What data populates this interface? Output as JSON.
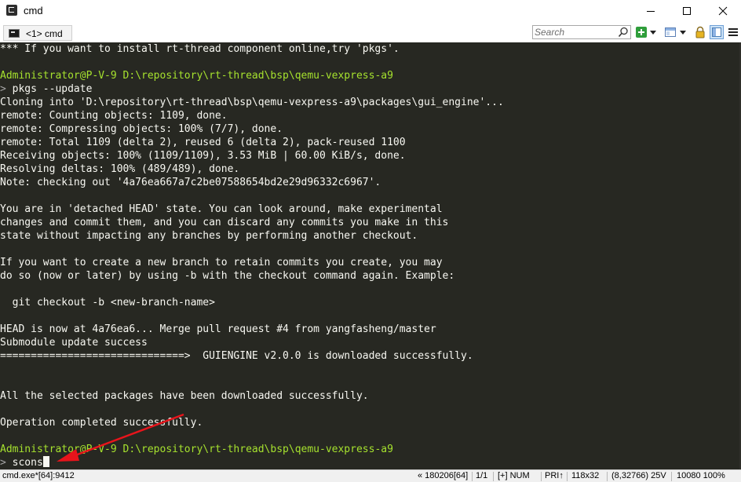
{
  "window": {
    "title": "cmd"
  },
  "tab": {
    "label": "<1> cmd"
  },
  "search": {
    "placeholder": "Search"
  },
  "console": {
    "lines": [
      {
        "text": "*** If you want to install rt-thread component online,try 'pkgs'."
      },
      {
        "text": ""
      },
      {
        "user": "Administrator@P-V-9",
        "path": " D:\\repository\\rt-thread\\bsp\\qemu-vexpress-a9"
      },
      {
        "arrow": ">",
        "cmd": " pkgs --update"
      },
      {
        "text": "Cloning into 'D:\\repository\\rt-thread\\bsp\\qemu-vexpress-a9\\packages\\gui_engine'..."
      },
      {
        "text": "remote: Counting objects: 1109, done."
      },
      {
        "text": "remote: Compressing objects: 100% (7/7), done."
      },
      {
        "text": "remote: Total 1109 (delta 2), reused 6 (delta 2), pack-reused 1100"
      },
      {
        "text": "Receiving objects: 100% (1109/1109), 3.53 MiB | 60.00 KiB/s, done."
      },
      {
        "text": "Resolving deltas: 100% (489/489), done."
      },
      {
        "text": "Note: checking out '4a76ea667a7c2be07588654bd2e29d96332c6967'."
      },
      {
        "text": ""
      },
      {
        "text": "You are in 'detached HEAD' state. You can look around, make experimental"
      },
      {
        "text": "changes and commit them, and you can discard any commits you make in this"
      },
      {
        "text": "state without impacting any branches by performing another checkout."
      },
      {
        "text": ""
      },
      {
        "text": "If you want to create a new branch to retain commits you create, you may"
      },
      {
        "text": "do so (now or later) by using -b with the checkout command again. Example:"
      },
      {
        "text": ""
      },
      {
        "text": "  git checkout -b <new-branch-name>"
      },
      {
        "text": ""
      },
      {
        "text": "HEAD is now at 4a76ea6... Merge pull request #4 from yangfasheng/master"
      },
      {
        "text": "Submodule update success"
      },
      {
        "text": "==============================>  GUIENGINE v2.0.0 is downloaded successfully."
      },
      {
        "text": ""
      },
      {
        "text": ""
      },
      {
        "text": "All the selected packages have been downloaded successfully."
      },
      {
        "text": ""
      },
      {
        "text": "Operation completed successfully."
      },
      {
        "text": ""
      },
      {
        "user": "Administrator@P-V-9",
        "path": " D:\\repository\\rt-thread\\bsp\\qemu-vexpress-a9"
      },
      {
        "arrow": ">",
        "cmd": " scons",
        "cursor": true
      }
    ]
  },
  "status": {
    "process": "cmd.exe*[64]:9412",
    "build": "« 180206[64]",
    "pages": "1/1",
    "mode": "[+] NUM",
    "priority": "PRI↑",
    "size": "118x32",
    "buffer": "(8,32766) 25V",
    "pid_zoom": "10080 100%"
  },
  "colors": {
    "console_bg": "#272822",
    "console_fg": "#f8f8f2",
    "prompt_green": "#a6e22e",
    "annotation_red": "#e8141b"
  },
  "icons": [
    "app-icon",
    "minimize-icon",
    "maximize-icon",
    "close-icon",
    "console-tab-icon",
    "search-icon",
    "new-console-icon",
    "dropdown-icon",
    "window-layout-icon",
    "lock-icon",
    "panel-toggle-icon",
    "menu-icon"
  ]
}
